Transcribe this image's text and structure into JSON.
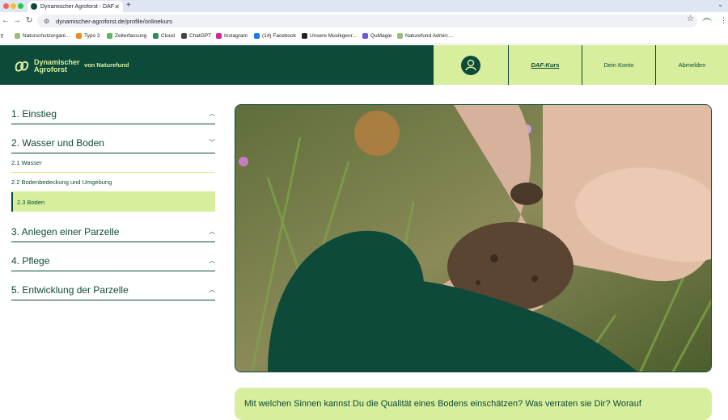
{
  "browser": {
    "tab_title": "Dynamischer Agroforst - DAF",
    "url": "dynamischer-agroforst.de/profile/onlinekurs",
    "bookmarks": [
      {
        "label": "Naturschutzorgani...",
        "color": "#9bbf7a"
      },
      {
        "label": "Typo 3",
        "color": "#f08a1c"
      },
      {
        "label": "Zeiterfassung",
        "color": "#5cb85c"
      },
      {
        "label": "Cloud",
        "color": "#2e8b57"
      },
      {
        "label": "ChatGPT",
        "color": "#444444"
      },
      {
        "label": "Instagram",
        "color": "#d6249f"
      },
      {
        "label": "(14) Facebook",
        "color": "#1877f2"
      },
      {
        "label": "Unsere Musikgenr...",
        "color": "#222222"
      },
      {
        "label": "QuMagie",
        "color": "#6a5acd"
      },
      {
        "label": "Naturefund Admin:...",
        "color": "#9bbf7a"
      }
    ]
  },
  "header": {
    "logo_line1": "Dynamischer",
    "logo_line2": "Agroforst",
    "subtitle": "von Naturefund",
    "nav": {
      "kurs": "DAF-Kurs",
      "konto": "Dein Konto",
      "logout": "Abmelden"
    }
  },
  "sidebar": {
    "sections": [
      {
        "label": "1. Einstieg",
        "chevron": "up"
      },
      {
        "label": "2. Wasser und Boden",
        "chevron": "down"
      },
      {
        "label": "3. Anlegen einer Parzelle",
        "chevron": "up"
      },
      {
        "label": "4. Pflege",
        "chevron": "up"
      },
      {
        "label": "5. Entwicklung der Parzelle",
        "chevron": "up"
      }
    ],
    "subitems": [
      "2.1 Wasser",
      "2.2 Bodenbedeckung und Umgebung",
      "2.3 Boden"
    ]
  },
  "question": "Mit welchen Sinnen kannst Du die Qualität eines Bodens einschätzen? Was verraten sie Dir? Worauf",
  "colors": {
    "brand_dark": "#0d4a3a",
    "brand_light": "#d7ee9c"
  }
}
